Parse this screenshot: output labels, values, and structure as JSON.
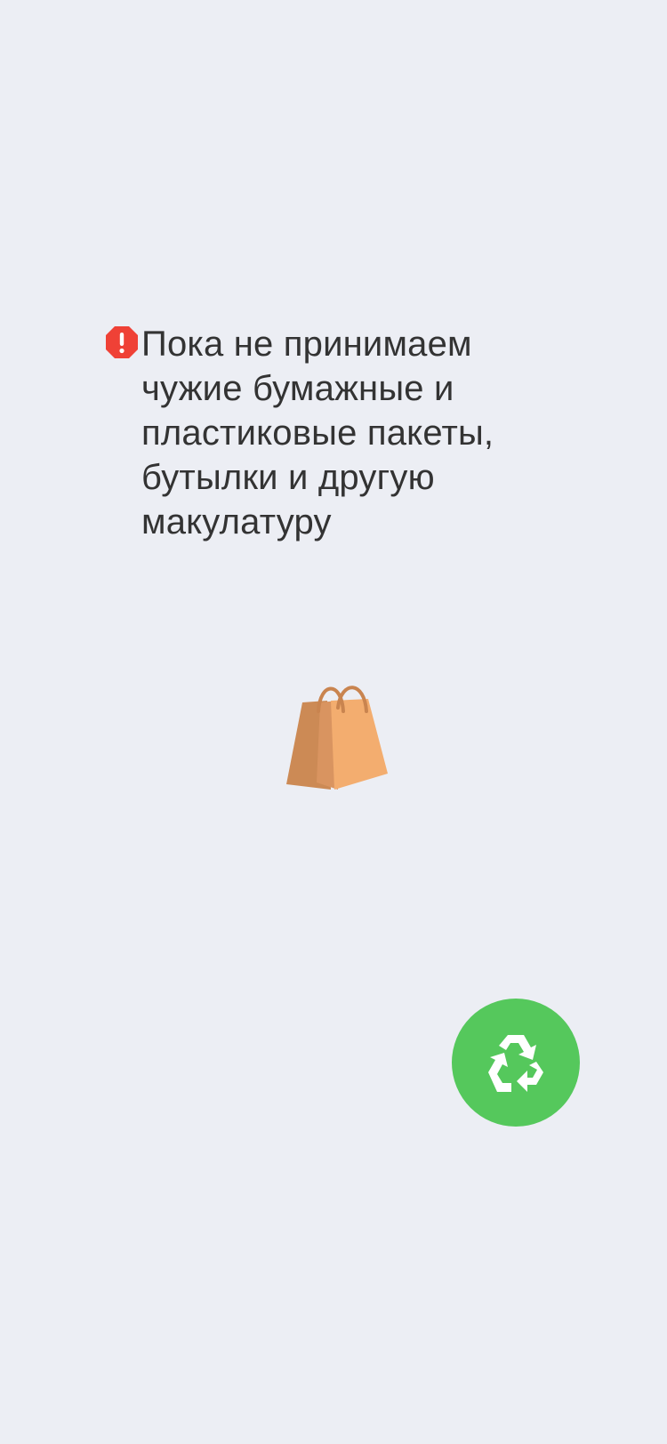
{
  "notice": {
    "text": "Пока не принимаем\nчужие бумажные и\nпластиковые пакеты,\nбутылки и другую\nмакулатуру",
    "icon": "exclamation-alert-icon",
    "icon_color": "#ef4136"
  },
  "illustration": {
    "icon": "shopping-bags-icon",
    "colors": [
      "#f3ad6f",
      "#d08a53"
    ]
  },
  "recycle_button": {
    "icon": "recycle-icon",
    "background": "#55c85c"
  },
  "background_color": "#eceef4"
}
